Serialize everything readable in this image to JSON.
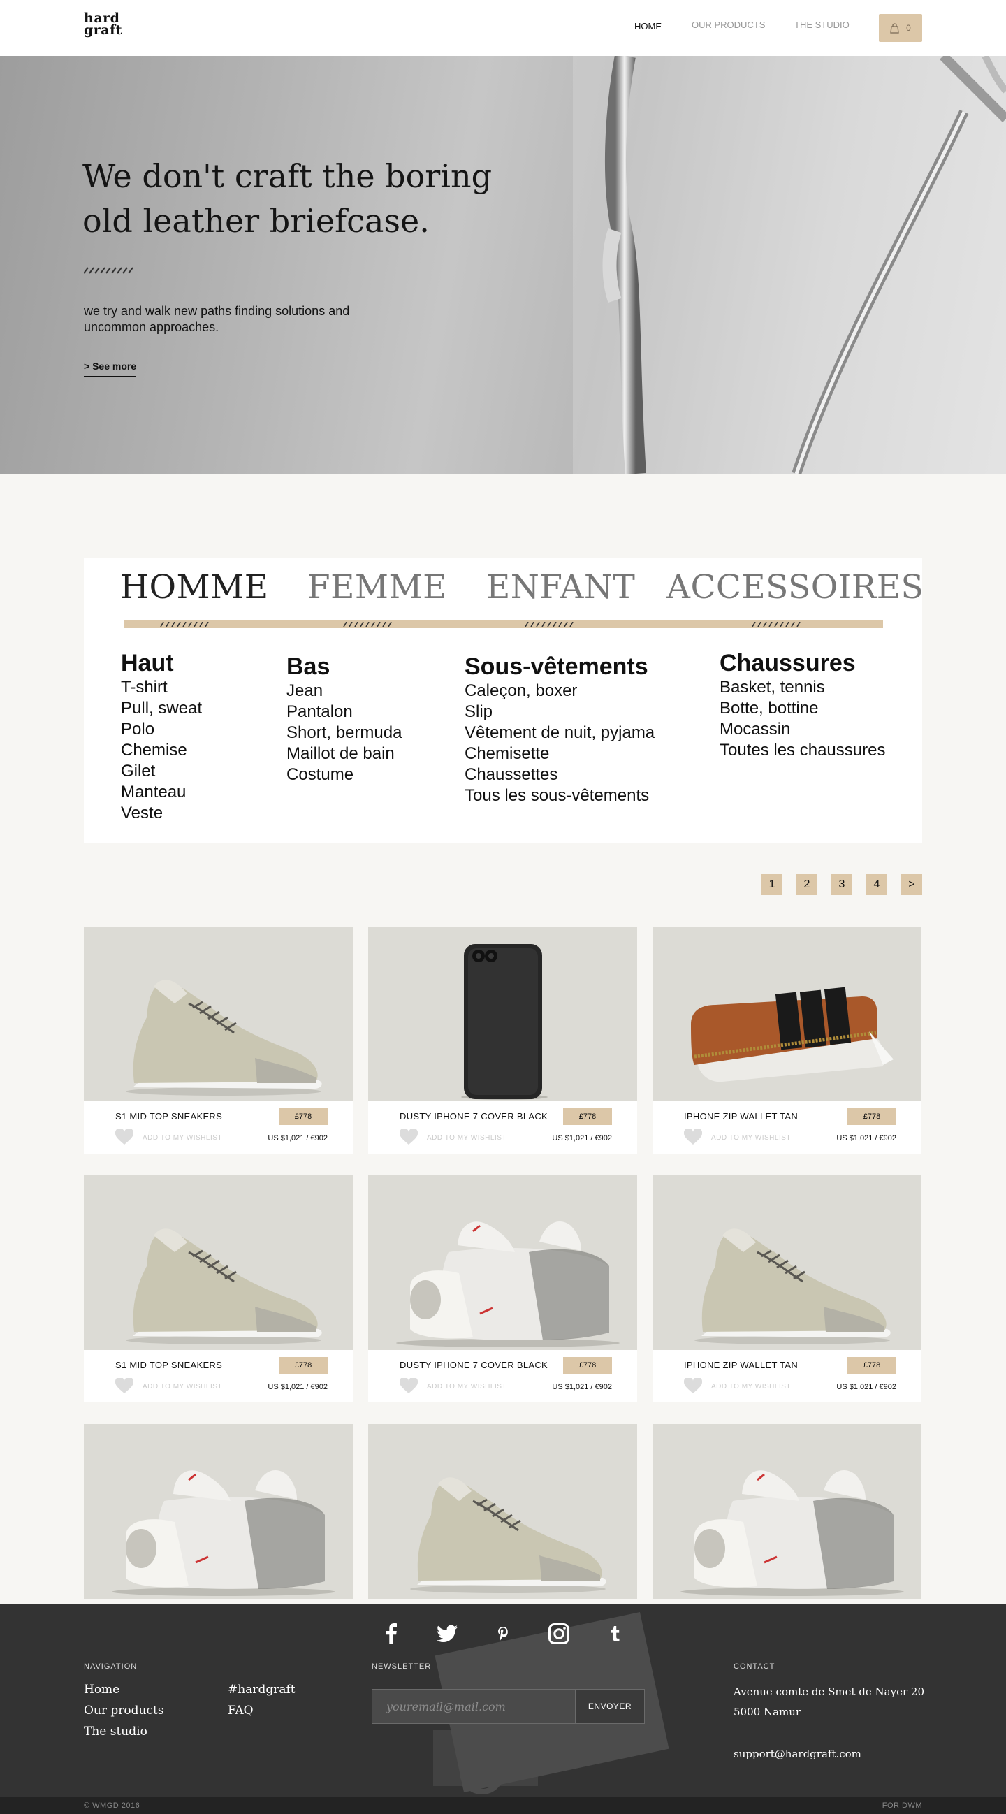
{
  "header": {
    "logo_line1": "hard",
    "logo_line2": "graft",
    "nav": [
      "HOME",
      "OUR PRODUCTS",
      "THE STUDIO"
    ],
    "cart_count": "0"
  },
  "hero": {
    "title_line1": "We don't craft the boring",
    "title_line2": "old leather briefcase.",
    "subtitle_line1": "we try and walk new paths finding solutions and",
    "subtitle_line2": "uncommon approaches.",
    "link": "> See more"
  },
  "categories": {
    "tabs": [
      "HOMME",
      "FEMME",
      "ENFANT",
      "ACCESSOIRES"
    ],
    "columns": [
      {
        "heading": "Haut",
        "items": [
          "T-shirt",
          "Pull, sweat",
          "Polo",
          "Chemise",
          "Gilet",
          "Manteau",
          "Veste"
        ]
      },
      {
        "heading": "Bas",
        "items": [
          "Jean",
          "Pantalon",
          "Short, bermuda",
          "Maillot de bain",
          "Costume"
        ]
      },
      {
        "heading": "Sous-vêtements",
        "items": [
          "Caleçon, boxer",
          "Slip",
          "Vêtement de nuit, pyjama",
          "Chemisette",
          "Chaussettes",
          "Tous les sous-vêtements"
        ]
      },
      {
        "heading": "Chaussures",
        "items": [
          "Basket, tennis",
          "Botte, bottine",
          "Mocassin",
          "Toutes les chaussures"
        ]
      }
    ]
  },
  "pagination": [
    "1",
    "2",
    "3",
    "4",
    ">"
  ],
  "products": [
    {
      "name": "S1 MID TOP SNEAKERS",
      "price": "£778",
      "wishlist": "ADD TO MY WISHLIST",
      "alt_price": "US $1,021 / €902",
      "image": "sneaker"
    },
    {
      "name": "DUSTY IPHONE 7 COVER BLACK",
      "price": "£778",
      "wishlist": "ADD TO MY WISHLIST",
      "alt_price": "US $1,021 / €902",
      "image": "phone-cover"
    },
    {
      "name": "IPHONE ZIP WALLET TAN",
      "price": "£778",
      "wishlist": "ADD TO MY WISHLIST",
      "alt_price": "US $1,021 / €902",
      "image": "wallet"
    },
    {
      "name": "S1 MID TOP SNEAKERS",
      "price": "£778",
      "wishlist": "ADD TO MY WISHLIST",
      "alt_price": "US $1,021 / €902",
      "image": "sneaker"
    },
    {
      "name": "DUSTY IPHONE 7 COVER BLACK",
      "price": "£778",
      "wishlist": "ADD TO MY WISHLIST",
      "alt_price": "US $1,021 / €902",
      "image": "slippers"
    },
    {
      "name": "IPHONE ZIP WALLET TAN",
      "price": "£778",
      "wishlist": "ADD TO MY WISHLIST",
      "alt_price": "US $1,021 / €902",
      "image": "sneaker"
    },
    {
      "image": "slippers"
    },
    {
      "image": "sneaker"
    },
    {
      "image": "slippers"
    }
  ],
  "footer": {
    "social": [
      "facebook-icon",
      "twitter-icon",
      "pinterest-icon",
      "instagram-icon",
      "tumblr-icon"
    ],
    "nav_label": "NAVIGATION",
    "nav_links": [
      "Home",
      "Our products",
      "The studio"
    ],
    "nav_links2": [
      "#hardgraft",
      "FAQ"
    ],
    "newsletter_label": "NEWSLETTER",
    "newsletter_placeholder": "youremail@mail.com",
    "newsletter_button": "ENVOYER",
    "contact_label": "CONTACT",
    "address_line1": "Avenue comte de Smet de Nayer 20",
    "address_line2": "5000 Namur",
    "email": "support@hardgraft.com",
    "copyright": "© WMGD 2016",
    "credit": "FOR DWM"
  },
  "colors": {
    "accent": "#dcc7a8",
    "footer_bg": "#333333",
    "product_bg": "#dcdbd5"
  }
}
